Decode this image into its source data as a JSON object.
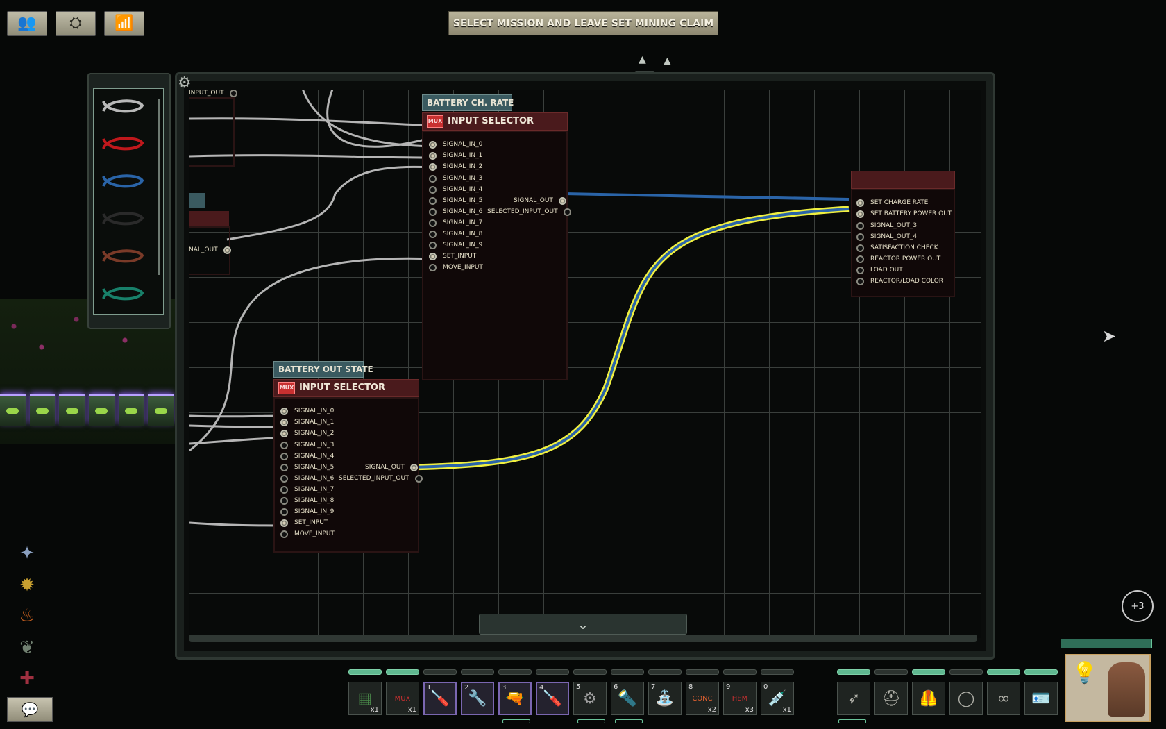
{
  "top_buttons": [
    {
      "name": "crew-button",
      "icon": "crew-icon",
      "glyph": "👥"
    },
    {
      "name": "command-button",
      "icon": "command-icon",
      "glyph": "⛭"
    },
    {
      "name": "stats-button",
      "icon": "stats-icon",
      "glyph": "📶"
    }
  ],
  "objective": "SELECT MISSION AND LEAVE SET MINING CLAIM",
  "wire_palette": {
    "colors": [
      "#b8b8b8",
      "#c0181c",
      "#2a64a8",
      "#2a2a2a",
      "#7a3a28",
      "#18806a"
    ]
  },
  "nodes": {
    "top_left_partial": {
      "pin": "INPUT_OUT"
    },
    "mid_left_partial": {
      "pin": "NAL_OUT"
    },
    "battery_ch_rate": {
      "label": "BATTERY CH. RATE",
      "title": "INPUT SELECTOR",
      "badge": "MUX",
      "inputs": [
        "SIGNAL_IN_0",
        "SIGNAL_IN_1",
        "SIGNAL_IN_2",
        "SIGNAL_IN_3",
        "SIGNAL_IN_4",
        "SIGNAL_IN_5",
        "SIGNAL_IN_6",
        "SIGNAL_IN_7",
        "SIGNAL_IN_8",
        "SIGNAL_IN_9",
        "SET_INPUT",
        "MOVE_INPUT"
      ],
      "outputs": [
        "SIGNAL_OUT",
        "SELECTED_INPUT_OUT"
      ]
    },
    "battery_out_state": {
      "label": "BATTERY OUT STATE",
      "title": "INPUT SELECTOR",
      "badge": "MUX",
      "inputs": [
        "SIGNAL_IN_0",
        "SIGNAL_IN_1",
        "SIGNAL_IN_2",
        "SIGNAL_IN_3",
        "SIGNAL_IN_4",
        "SIGNAL_IN_5",
        "SIGNAL_IN_6",
        "SIGNAL_IN_7",
        "SIGNAL_IN_8",
        "SIGNAL_IN_9",
        "SET_INPUT",
        "MOVE_INPUT"
      ],
      "outputs": [
        "SIGNAL_OUT",
        "SELECTED_INPUT_OUT"
      ]
    },
    "target_component": {
      "title": "",
      "pins": [
        "SET CHARGE RATE",
        "SET BATTERY POWER OUT",
        "SIGNAL_OUT_3",
        "SIGNAL_OUT_4",
        "SATISFACTION CHECK",
        "REACTOR POWER OUT",
        "LOAD OUT",
        "REACTOR/LOAD COLOR"
      ]
    }
  },
  "collapse_button": {
    "icon": "chevron-down-icon",
    "glyph": "⌄"
  },
  "side_icons": [
    {
      "name": "mechanic-skill-icon",
      "glyph": "✦",
      "color": "#8aa0c0"
    },
    {
      "name": "engineer-skill-icon",
      "glyph": "✹",
      "color": "#c8a030"
    },
    {
      "name": "fire-skill-icon",
      "glyph": "♨",
      "color": "#c86020"
    },
    {
      "name": "plant-skill-icon",
      "glyph": "❦",
      "color": "#708070"
    },
    {
      "name": "medic-skill-icon",
      "glyph": "✚",
      "color": "#a03040"
    }
  ],
  "chat_button": {
    "glyph": "💬"
  },
  "notification_badge": "+3",
  "hotbar": {
    "slots": [
      {
        "num": "",
        "count": "x1",
        "icon": "circuit-board-icon",
        "glyph": "▦",
        "color": "#4a8a4a",
        "selected": false
      },
      {
        "num": "",
        "count": "x1",
        "icon": "mux-icon",
        "glyph": "MUX",
        "color": "#c83030",
        "selected": false
      },
      {
        "num": "1",
        "count": "",
        "icon": "screwdriver-icon",
        "glyph": "🪛",
        "color": "#d0a030",
        "selected": true
      },
      {
        "num": "2",
        "count": "",
        "icon": "wrench-icon",
        "glyph": "🔧",
        "color": "#b0b0b0",
        "selected": true
      },
      {
        "num": "3",
        "count": "",
        "icon": "gun-icon",
        "glyph": "🔫",
        "color": "#a06040",
        "selected": true
      },
      {
        "num": "4",
        "count": "",
        "icon": "screwdriver-icon",
        "glyph": "🪛",
        "color": "#d0a030",
        "selected": true
      },
      {
        "num": "5",
        "count": "",
        "icon": "diving-mask-icon",
        "glyph": "⚙",
        "color": "#a0a0a0",
        "selected": false
      },
      {
        "num": "6",
        "count": "",
        "icon": "flashlight-icon",
        "glyph": "🔦",
        "color": "#c0c0c0",
        "selected": false
      },
      {
        "num": "7",
        "count": "",
        "icon": "watering-can-icon",
        "glyph": "⛲",
        "color": "#b0b0b0",
        "selected": false
      },
      {
        "num": "8",
        "count": "x2",
        "icon": "conc-ammo-icon",
        "glyph": "CONC",
        "color": "#e06030",
        "selected": false
      },
      {
        "num": "9",
        "count": "x3",
        "icon": "hem-ammo-icon",
        "glyph": "HEM",
        "color": "#c83030",
        "selected": false
      },
      {
        "num": "0",
        "count": "x1",
        "icon": "syringe-icon",
        "glyph": "💉",
        "color": "#c0c0c0",
        "selected": false
      }
    ],
    "bar_fill": [
      true,
      true,
      false,
      false,
      false,
      false,
      false,
      false,
      false,
      false,
      false,
      false
    ]
  },
  "equipment": {
    "slots": [
      {
        "icon": "harpoon-gun-icon",
        "glyph": "➶"
      },
      {
        "icon": "helmet-icon",
        "glyph": "⛑"
      },
      {
        "icon": "vest-icon",
        "glyph": "🦺"
      },
      {
        "icon": "diving-suit-icon",
        "glyph": "◯"
      },
      {
        "icon": "goggles-icon",
        "glyph": "∞"
      },
      {
        "icon": "id-card-icon",
        "glyph": "🪪"
      }
    ],
    "bar_fill": [
      true,
      false,
      true,
      false,
      true,
      true
    ]
  },
  "portrait": {
    "name": "character-portrait",
    "job_icon": "lightbulb-icon",
    "glyph": "💡"
  },
  "pointer_glyph": "▲"
}
